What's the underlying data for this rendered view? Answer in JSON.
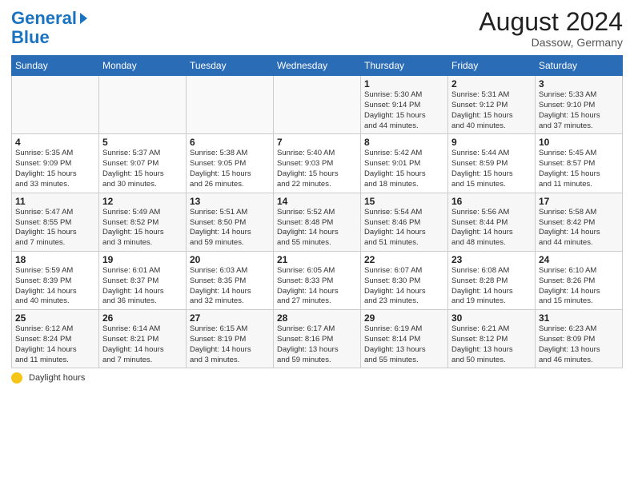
{
  "header": {
    "logo_general": "General",
    "logo_blue": "Blue",
    "month_year": "August 2024",
    "location": "Dassow, Germany"
  },
  "days_of_week": [
    "Sunday",
    "Monday",
    "Tuesday",
    "Wednesday",
    "Thursday",
    "Friday",
    "Saturday"
  ],
  "weeks": [
    [
      {
        "day": "",
        "info": ""
      },
      {
        "day": "",
        "info": ""
      },
      {
        "day": "",
        "info": ""
      },
      {
        "day": "",
        "info": ""
      },
      {
        "day": "1",
        "info": "Sunrise: 5:30 AM\nSunset: 9:14 PM\nDaylight: 15 hours\nand 44 minutes."
      },
      {
        "day": "2",
        "info": "Sunrise: 5:31 AM\nSunset: 9:12 PM\nDaylight: 15 hours\nand 40 minutes."
      },
      {
        "day": "3",
        "info": "Sunrise: 5:33 AM\nSunset: 9:10 PM\nDaylight: 15 hours\nand 37 minutes."
      }
    ],
    [
      {
        "day": "4",
        "info": "Sunrise: 5:35 AM\nSunset: 9:09 PM\nDaylight: 15 hours\nand 33 minutes."
      },
      {
        "day": "5",
        "info": "Sunrise: 5:37 AM\nSunset: 9:07 PM\nDaylight: 15 hours\nand 30 minutes."
      },
      {
        "day": "6",
        "info": "Sunrise: 5:38 AM\nSunset: 9:05 PM\nDaylight: 15 hours\nand 26 minutes."
      },
      {
        "day": "7",
        "info": "Sunrise: 5:40 AM\nSunset: 9:03 PM\nDaylight: 15 hours\nand 22 minutes."
      },
      {
        "day": "8",
        "info": "Sunrise: 5:42 AM\nSunset: 9:01 PM\nDaylight: 15 hours\nand 18 minutes."
      },
      {
        "day": "9",
        "info": "Sunrise: 5:44 AM\nSunset: 8:59 PM\nDaylight: 15 hours\nand 15 minutes."
      },
      {
        "day": "10",
        "info": "Sunrise: 5:45 AM\nSunset: 8:57 PM\nDaylight: 15 hours\nand 11 minutes."
      }
    ],
    [
      {
        "day": "11",
        "info": "Sunrise: 5:47 AM\nSunset: 8:55 PM\nDaylight: 15 hours\nand 7 minutes."
      },
      {
        "day": "12",
        "info": "Sunrise: 5:49 AM\nSunset: 8:52 PM\nDaylight: 15 hours\nand 3 minutes."
      },
      {
        "day": "13",
        "info": "Sunrise: 5:51 AM\nSunset: 8:50 PM\nDaylight: 14 hours\nand 59 minutes."
      },
      {
        "day": "14",
        "info": "Sunrise: 5:52 AM\nSunset: 8:48 PM\nDaylight: 14 hours\nand 55 minutes."
      },
      {
        "day": "15",
        "info": "Sunrise: 5:54 AM\nSunset: 8:46 PM\nDaylight: 14 hours\nand 51 minutes."
      },
      {
        "day": "16",
        "info": "Sunrise: 5:56 AM\nSunset: 8:44 PM\nDaylight: 14 hours\nand 48 minutes."
      },
      {
        "day": "17",
        "info": "Sunrise: 5:58 AM\nSunset: 8:42 PM\nDaylight: 14 hours\nand 44 minutes."
      }
    ],
    [
      {
        "day": "18",
        "info": "Sunrise: 5:59 AM\nSunset: 8:39 PM\nDaylight: 14 hours\nand 40 minutes."
      },
      {
        "day": "19",
        "info": "Sunrise: 6:01 AM\nSunset: 8:37 PM\nDaylight: 14 hours\nand 36 minutes."
      },
      {
        "day": "20",
        "info": "Sunrise: 6:03 AM\nSunset: 8:35 PM\nDaylight: 14 hours\nand 32 minutes."
      },
      {
        "day": "21",
        "info": "Sunrise: 6:05 AM\nSunset: 8:33 PM\nDaylight: 14 hours\nand 27 minutes."
      },
      {
        "day": "22",
        "info": "Sunrise: 6:07 AM\nSunset: 8:30 PM\nDaylight: 14 hours\nand 23 minutes."
      },
      {
        "day": "23",
        "info": "Sunrise: 6:08 AM\nSunset: 8:28 PM\nDaylight: 14 hours\nand 19 minutes."
      },
      {
        "day": "24",
        "info": "Sunrise: 6:10 AM\nSunset: 8:26 PM\nDaylight: 14 hours\nand 15 minutes."
      }
    ],
    [
      {
        "day": "25",
        "info": "Sunrise: 6:12 AM\nSunset: 8:24 PM\nDaylight: 14 hours\nand 11 minutes."
      },
      {
        "day": "26",
        "info": "Sunrise: 6:14 AM\nSunset: 8:21 PM\nDaylight: 14 hours\nand 7 minutes."
      },
      {
        "day": "27",
        "info": "Sunrise: 6:15 AM\nSunset: 8:19 PM\nDaylight: 14 hours\nand 3 minutes."
      },
      {
        "day": "28",
        "info": "Sunrise: 6:17 AM\nSunset: 8:16 PM\nDaylight: 13 hours\nand 59 minutes."
      },
      {
        "day": "29",
        "info": "Sunrise: 6:19 AM\nSunset: 8:14 PM\nDaylight: 13 hours\nand 55 minutes."
      },
      {
        "day": "30",
        "info": "Sunrise: 6:21 AM\nSunset: 8:12 PM\nDaylight: 13 hours\nand 50 minutes."
      },
      {
        "day": "31",
        "info": "Sunrise: 6:23 AM\nSunset: 8:09 PM\nDaylight: 13 hours\nand 46 minutes."
      }
    ]
  ],
  "footer": {
    "daylight_label": "Daylight hours"
  }
}
